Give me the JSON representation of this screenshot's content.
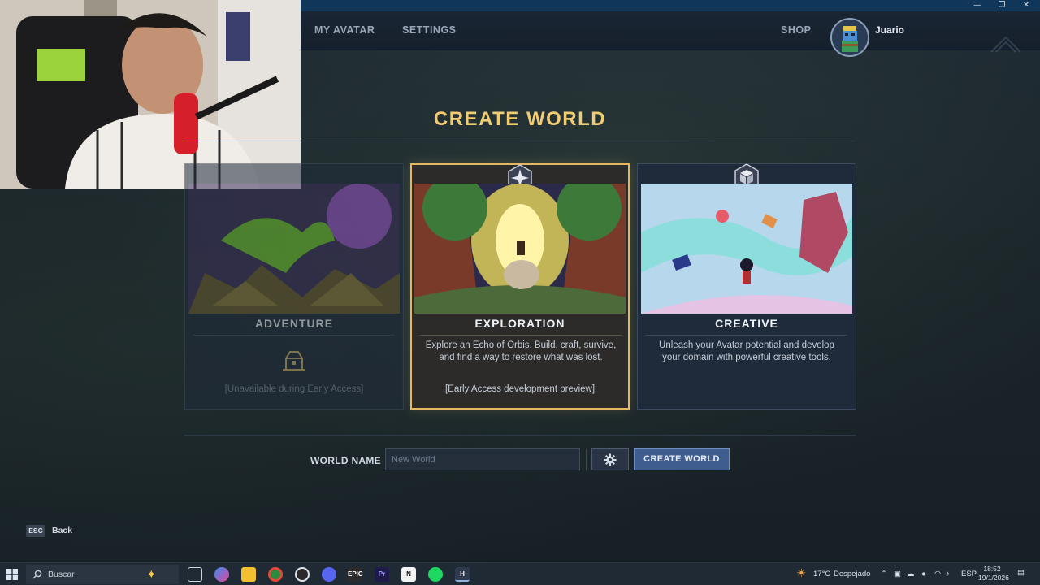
{
  "window": {
    "minimize_glyph": "—",
    "restore_glyph": "❐",
    "close_glyph": "✕"
  },
  "nav": {
    "items": [
      {
        "label": "MY AVATAR"
      },
      {
        "label": "SETTINGS"
      }
    ],
    "shop_label": "SHOP",
    "username": "Juario"
  },
  "page": {
    "title": "CREATE WORLD"
  },
  "cards": [
    {
      "title": "ADVENTURE",
      "description": "",
      "note": "[Unavailable during Early Access]",
      "state": "unavailable",
      "icon": "locked-chest-icon"
    },
    {
      "title": "EXPLORATION",
      "description": "Explore an Echo of Orbis. Build, craft, survive, and find a way to restore what was lost.",
      "note": "[Early Access development preview]",
      "state": "selected",
      "icon": "compass-icon"
    },
    {
      "title": "CREATIVE",
      "description": "Unleash your Avatar potential and develop your domain with powerful creative tools.",
      "note": "",
      "state": "available",
      "icon": "cube-icon"
    }
  ],
  "form": {
    "world_name_label": "WORLD NAME",
    "world_name_placeholder": "New World",
    "world_name_value": "",
    "settings_icon": "gear-icon",
    "create_button": "CREATE WORLD"
  },
  "footer": {
    "esc_key": "ESC",
    "back_label": "Back"
  },
  "taskbar": {
    "search_placeholder": "Buscar",
    "weather_temp": "17°C",
    "weather_text": "Despejado",
    "language": "ESP",
    "time": "18:52",
    "date": "19/1/2026",
    "apps": [
      "copilot",
      "task-view",
      "edge-copilot",
      "file-explorer",
      "chrome",
      "obs",
      "discord",
      "epic-games",
      "premiere-pro",
      "notion",
      "spotify",
      "hytale"
    ]
  },
  "colors": {
    "accent_gold": "#f1cc72",
    "selected_border": "#e2b862",
    "button_blue": "#3f5d8e",
    "window_bar": "#10365a"
  }
}
